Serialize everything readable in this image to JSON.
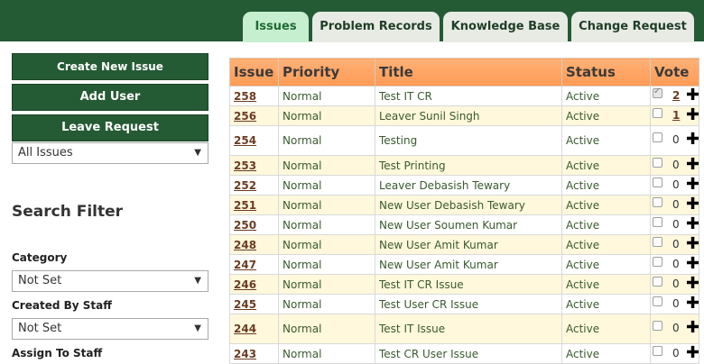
{
  "tabs": [
    {
      "label": "Issues",
      "active": true
    },
    {
      "label": "Problem Records",
      "active": false
    },
    {
      "label": "Knowledge Base",
      "active": false
    },
    {
      "label": "Change Request",
      "active": false
    }
  ],
  "sidebar": {
    "buttons": [
      "Create New Issue",
      "Add User",
      "Leave Request"
    ],
    "issue_filter": "All Issues",
    "search_filter_title": "Search Filter",
    "filters": [
      {
        "label": "Category",
        "value": "Not Set"
      },
      {
        "label": "Created By Staff",
        "value": "Not Set"
      },
      {
        "label": "Assign To Staff",
        "value": ""
      }
    ]
  },
  "table": {
    "headers": [
      "Issue",
      "Priority",
      "Title",
      "Status",
      "Vote"
    ],
    "rows": [
      {
        "issue": "258",
        "priority": "Normal",
        "title": "Test IT CR",
        "status": "Active",
        "votes": "2",
        "checked": true
      },
      {
        "issue": "256",
        "priority": "Normal",
        "title": "Leaver Sunil Singh",
        "status": "Active",
        "votes": "1",
        "checked": false
      },
      {
        "issue": "254",
        "priority": "Normal",
        "title": "Testing",
        "status": "Active",
        "votes": "0",
        "checked": false
      },
      {
        "issue": "253",
        "priority": "Normal",
        "title": "Test Printing",
        "status": "Active",
        "votes": "0",
        "checked": false
      },
      {
        "issue": "252",
        "priority": "Normal",
        "title": "Leaver Debasish Tewary",
        "status": "Active",
        "votes": "0",
        "checked": false
      },
      {
        "issue": "251",
        "priority": "Normal",
        "title": "New User Debasish Tewary",
        "status": "Active",
        "votes": "0",
        "checked": false
      },
      {
        "issue": "250",
        "priority": "Normal",
        "title": "New User Soumen Kumar",
        "status": "Active",
        "votes": "0",
        "checked": false
      },
      {
        "issue": "248",
        "priority": "Normal",
        "title": "New User Amit Kumar",
        "status": "Active",
        "votes": "0",
        "checked": false
      },
      {
        "issue": "247",
        "priority": "Normal",
        "title": "New User Amit Kumar",
        "status": "Active",
        "votes": "0",
        "checked": false
      },
      {
        "issue": "246",
        "priority": "Normal",
        "title": "Test IT CR Issue",
        "status": "Active",
        "votes": "0",
        "checked": false
      },
      {
        "issue": "245",
        "priority": "Normal",
        "title": "Test User CR Issue",
        "status": "Active",
        "votes": "0",
        "checked": false
      },
      {
        "issue": "244",
        "priority": "Normal",
        "title": "Test IT Issue",
        "status": "Active",
        "votes": "0",
        "checked": false
      },
      {
        "issue": "243",
        "priority": "Normal",
        "title": "Test CR User Issue",
        "status": "Active",
        "votes": "0",
        "checked": false
      }
    ]
  },
  "colors": {
    "topbar": "#245a34",
    "active_tab": "#c6efcf",
    "header_orange": "#ff9a55",
    "alt_row": "#fff8dc",
    "link": "#6b3c22"
  }
}
